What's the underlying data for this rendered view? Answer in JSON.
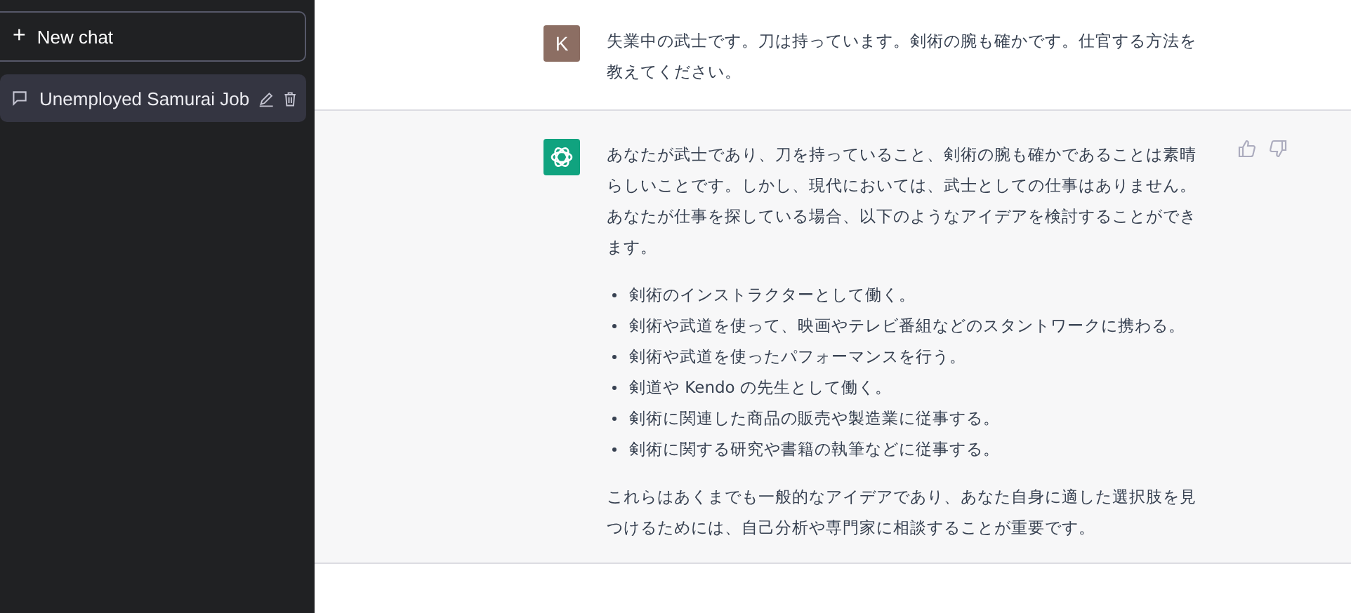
{
  "sidebar": {
    "new_chat": {
      "icon": "+",
      "label": "New chat"
    },
    "items": [
      {
        "label": "Unemployed Samurai Job",
        "selected": true
      }
    ]
  },
  "messages": [
    {
      "kind": "user",
      "avatar": "K",
      "blocks": [
        {
          "kind": "paragraph",
          "text": "失業中の武士です。刀は持っています。剣術の腕も確かです。仕官する方法を教えてください。"
        }
      ]
    },
    {
      "kind": "assistant",
      "blocks": [
        {
          "kind": "paragraph",
          "text": "あなたが武士であり、刀を持っていること、剣術の腕も確かであることは素晴らしいことです。しかし、現代においては、武士としての仕事はありません。あなたが仕事を探している場合、以下のようなアイデアを検討することができます。"
        },
        {
          "kind": "list",
          "items": [
            "剣術のインストラクターとして働く。",
            "剣術や武道を使って、映画やテレビ番組などのスタントワークに携わる。",
            "剣術や武道を使ったパフォーマンスを行う。",
            "剣道や Kendo の先生として働く。",
            "剣術に関連した商品の販売や製造業に従事する。",
            "剣術に関する研究や書籍の執筆などに従事する。"
          ]
        },
        {
          "kind": "paragraph",
          "text": "これらはあくまでも一般的なアイデアであり、あなた自身に適した選択肢を見つけるためには、自己分析や専門家に相談することが重要です。"
        }
      ]
    }
  ]
}
